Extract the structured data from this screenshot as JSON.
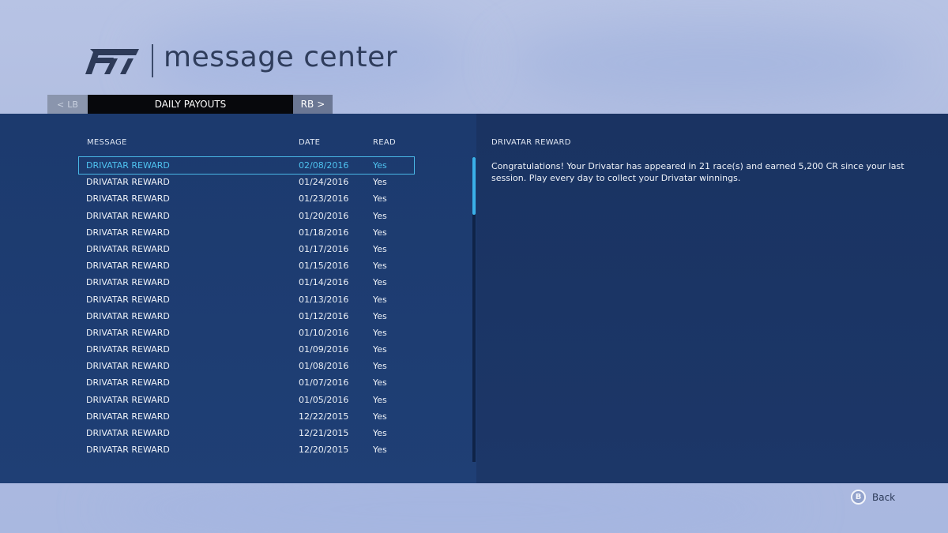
{
  "header": {
    "title": "message center"
  },
  "tabs": {
    "prev_label": "LB",
    "current_label": "DAILY PAYOUTS",
    "next_label": "RB"
  },
  "list": {
    "columns": {
      "message": "MESSAGE",
      "date": "DATE",
      "read": "READ"
    },
    "rows": [
      {
        "message": "DRIVATAR REWARD",
        "date": "02/08/2016",
        "read": "Yes"
      },
      {
        "message": "DRIVATAR REWARD",
        "date": "01/24/2016",
        "read": "Yes"
      },
      {
        "message": "DRIVATAR REWARD",
        "date": "01/23/2016",
        "read": "Yes"
      },
      {
        "message": "DRIVATAR REWARD",
        "date": "01/20/2016",
        "read": "Yes"
      },
      {
        "message": "DRIVATAR REWARD",
        "date": "01/18/2016",
        "read": "Yes"
      },
      {
        "message": "DRIVATAR REWARD",
        "date": "01/17/2016",
        "read": "Yes"
      },
      {
        "message": "DRIVATAR REWARD",
        "date": "01/15/2016",
        "read": "Yes"
      },
      {
        "message": "DRIVATAR REWARD",
        "date": "01/14/2016",
        "read": "Yes"
      },
      {
        "message": "DRIVATAR REWARD",
        "date": "01/13/2016",
        "read": "Yes"
      },
      {
        "message": "DRIVATAR REWARD",
        "date": "01/12/2016",
        "read": "Yes"
      },
      {
        "message": "DRIVATAR REWARD",
        "date": "01/10/2016",
        "read": "Yes"
      },
      {
        "message": "DRIVATAR REWARD",
        "date": "01/09/2016",
        "read": "Yes"
      },
      {
        "message": "DRIVATAR REWARD",
        "date": "01/08/2016",
        "read": "Yes"
      },
      {
        "message": "DRIVATAR REWARD",
        "date": "01/07/2016",
        "read": "Yes"
      },
      {
        "message": "DRIVATAR REWARD",
        "date": "01/05/2016",
        "read": "Yes"
      },
      {
        "message": "DRIVATAR REWARD",
        "date": "12/22/2015",
        "read": "Yes"
      },
      {
        "message": "DRIVATAR REWARD",
        "date": "12/21/2015",
        "read": "Yes"
      },
      {
        "message": "DRIVATAR REWARD",
        "date": "12/20/2015",
        "read": "Yes"
      }
    ]
  },
  "detail": {
    "title": "DRIVATAR REWARD",
    "body": "Congratulations! Your Drivatar has appeared in 21 race(s) and earned 5,200 CR since your last session. Play every day to collect your Drivatar winnings."
  },
  "footer": {
    "back_button_glyph": "B",
    "back_label": "Back"
  },
  "colors": {
    "accent": "#3ab0e8",
    "selected_text": "#4fc3f0"
  },
  "icons": {
    "logo": "forza-logo",
    "prev": "chevron-left-icon",
    "next": "chevron-right-icon",
    "back": "b-button-icon"
  }
}
